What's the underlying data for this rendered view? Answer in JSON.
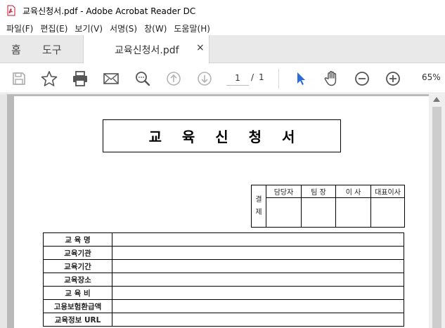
{
  "window": {
    "title": "교육신청서.pdf - Adobe Acrobat Reader DC"
  },
  "menu": [
    {
      "label": "파일(F)"
    },
    {
      "label": "편집(E)"
    },
    {
      "label": "보기(V)"
    },
    {
      "label": "서명(S)"
    },
    {
      "label": "창(W)"
    },
    {
      "label": "도움말(H)"
    }
  ],
  "tabs": {
    "home": "홈",
    "tools": "도구",
    "document": "교육신청서.pdf",
    "close": "×"
  },
  "toolbar": {
    "icons": [
      "save-icon",
      "star-icon",
      "print-icon",
      "mail-icon",
      "search-zoom-icon",
      "page-up-icon",
      "page-down-icon",
      "select-cursor-icon",
      "hand-icon",
      "zoom-out-icon",
      "zoom-in-icon"
    ],
    "page_current": "1",
    "page_separator": "/",
    "page_total": "1",
    "zoom": "65%",
    "accent_color": "#2d6ed6"
  },
  "document": {
    "title": "교 육 신 청 서",
    "approval": {
      "side_label": "결\n제",
      "headers": [
        "담당자",
        "팀 장",
        "이 사",
        "대표이사"
      ]
    },
    "info_rows": [
      {
        "label": "교 육 명",
        "value": ""
      },
      {
        "label": "교육기관",
        "value": ""
      },
      {
        "label": "교육기간",
        "value": ""
      },
      {
        "label": "교육장소",
        "value": ""
      },
      {
        "label": "교 육 비",
        "value": ""
      },
      {
        "label": "고용보험환급액",
        "value": ""
      },
      {
        "label": "교육정보 URL",
        "value": ""
      }
    ]
  }
}
